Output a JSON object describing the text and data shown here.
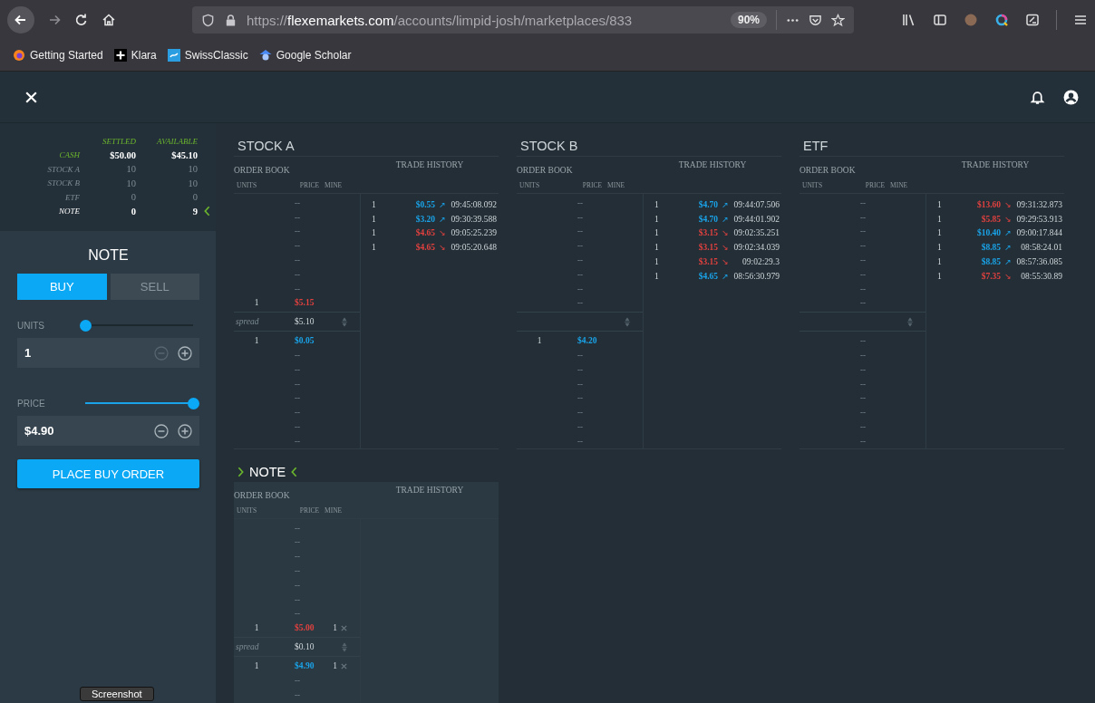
{
  "browser": {
    "url": "https://**flexemarkets.com**/accounts/limpid-josh/marketplaces/833",
    "zoom": "90%",
    "bookmarks": [
      {
        "label": "Getting Started",
        "kind": "firefox"
      },
      {
        "label": "Klara",
        "kind": "plus"
      },
      {
        "label": "SwissClassic",
        "kind": "swiss"
      },
      {
        "label": "Google Scholar",
        "kind": "scholar"
      }
    ]
  },
  "holdings": {
    "columns": [
      "SETTLED",
      "AVAILABLE"
    ],
    "rows": [
      {
        "kind": "cash",
        "label": "CASH",
        "settled": "$50.00",
        "available": "$45.10",
        "selected": false
      },
      {
        "kind": "holding",
        "label": "STOCK A",
        "settled": "10",
        "available": "10",
        "selected": false
      },
      {
        "kind": "holding",
        "label": "STOCK B",
        "settled": "10",
        "available": "10",
        "selected": false
      },
      {
        "kind": "holding",
        "label": "ETF",
        "settled": "0",
        "available": "0",
        "selected": false
      },
      {
        "kind": "holding",
        "label": "NOTE",
        "settled": "0",
        "available": "9",
        "selected": true
      }
    ]
  },
  "order_form": {
    "title": "NOTE",
    "tabs": [
      {
        "label": "BUY",
        "selected": true
      },
      {
        "label": "SELL",
        "selected": false
      }
    ],
    "fields": [
      {
        "label": "UNITS",
        "level": 0,
        "value": "1",
        "minus_disabled": true
      },
      {
        "label": "PRICE",
        "level": 1,
        "value": "$4.90",
        "minus_disabled": false
      }
    ],
    "submit": "PLACE BUY ORDER"
  },
  "markets": [
    {
      "title": "STOCK A",
      "selected": false,
      "order_book": {
        "heading": "ORDER BOOK",
        "columns": [
          "UNITS",
          "PRICE",
          "MINE"
        ],
        "asks": [
          {
            "price": "--"
          },
          {
            "price": "--"
          },
          {
            "price": "--"
          },
          {
            "price": "--"
          },
          {
            "price": "--"
          },
          {
            "price": "--"
          },
          {
            "price": "--"
          },
          {
            "units": "1",
            "price": "$5.15"
          }
        ],
        "spread": {
          "label": "spread",
          "value": "$5.10"
        },
        "bids": [
          {
            "units": "1",
            "price": "$0.05"
          },
          {
            "price": "--"
          },
          {
            "price": "--"
          },
          {
            "price": "--"
          },
          {
            "price": "--"
          },
          {
            "price": "--"
          },
          {
            "price": "--"
          },
          {
            "price": "--"
          }
        ]
      },
      "trade_history": {
        "heading": "TRADE HISTORY",
        "trades": [
          {
            "units": "1",
            "price": "$0.55",
            "arrow": "↗",
            "rising": true,
            "time": "09:45:08.092"
          },
          {
            "units": "1",
            "price": "$3.20",
            "arrow": "↗",
            "rising": true,
            "time": "09:30:39.588"
          },
          {
            "units": "1",
            "price": "$4.65",
            "arrow": "↘",
            "rising": false,
            "time": "09:05:25.239"
          },
          {
            "units": "1",
            "price": "$4.65",
            "arrow": "↘",
            "rising": false,
            "time": "09:05:20.648"
          }
        ]
      }
    },
    {
      "title": "STOCK B",
      "selected": false,
      "order_book": {
        "heading": "ORDER BOOK",
        "columns": [
          "UNITS",
          "PRICE",
          "MINE"
        ],
        "asks": [
          {
            "price": "--"
          },
          {
            "price": "--"
          },
          {
            "price": "--"
          },
          {
            "price": "--"
          },
          {
            "price": "--"
          },
          {
            "price": "--"
          },
          {
            "price": "--"
          },
          {
            "price": "--"
          }
        ],
        "bids": [
          {
            "units": "1",
            "price": "$4.20"
          },
          {
            "price": "--"
          },
          {
            "price": "--"
          },
          {
            "price": "--"
          },
          {
            "price": "--"
          },
          {
            "price": "--"
          },
          {
            "price": "--"
          },
          {
            "price": "--"
          }
        ]
      },
      "trade_history": {
        "heading": "TRADE HISTORY",
        "trades": [
          {
            "units": "1",
            "price": "$4.70",
            "arrow": "↗",
            "rising": true,
            "time": "09:44:07.506"
          },
          {
            "units": "1",
            "price": "$4.70",
            "arrow": "↗",
            "rising": true,
            "time": "09:44:01.902"
          },
          {
            "units": "1",
            "price": "$3.15",
            "arrow": "↘",
            "rising": false,
            "time": "09:02:35.251"
          },
          {
            "units": "1",
            "price": "$3.15",
            "arrow": "↘",
            "rising": false,
            "time": "09:02:34.039"
          },
          {
            "units": "1",
            "price": "$3.15",
            "arrow": "↘",
            "rising": false,
            "time": "09:02:29.3"
          },
          {
            "units": "1",
            "price": "$4.65",
            "arrow": "↗",
            "rising": true,
            "time": "08:56:30.979"
          }
        ]
      }
    },
    {
      "title": "ETF",
      "selected": false,
      "order_book": {
        "heading": "ORDER BOOK",
        "columns": [
          "UNITS",
          "PRICE",
          "MINE"
        ],
        "asks": [
          {
            "price": "--"
          },
          {
            "price": "--"
          },
          {
            "price": "--"
          },
          {
            "price": "--"
          },
          {
            "price": "--"
          },
          {
            "price": "--"
          },
          {
            "price": "--"
          },
          {
            "price": "--"
          }
        ],
        "bids": [
          {
            "price": "--"
          },
          {
            "price": "--"
          },
          {
            "price": "--"
          },
          {
            "price": "--"
          },
          {
            "price": "--"
          },
          {
            "price": "--"
          },
          {
            "price": "--"
          },
          {
            "price": "--"
          }
        ]
      },
      "trade_history": {
        "heading": "TRADE HISTORY",
        "trades": [
          {
            "units": "1",
            "price": "$13.60",
            "arrow": "↘",
            "rising": false,
            "time": "09:31:32.873"
          },
          {
            "units": "1",
            "price": "$5.85",
            "arrow": "↘",
            "rising": false,
            "time": "09:29:53.913"
          },
          {
            "units": "1",
            "price": "$10.40",
            "arrow": "↗",
            "rising": true,
            "time": "09:00:17.844"
          },
          {
            "units": "1",
            "price": "$8.85",
            "arrow": "↗",
            "rising": true,
            "time": "08:58:24.01"
          },
          {
            "units": "1",
            "price": "$8.85",
            "arrow": "↗",
            "rising": true,
            "time": "08:57:36.085"
          },
          {
            "units": "1",
            "price": "$7.35",
            "arrow": "↘",
            "rising": false,
            "time": "08:55:30.89"
          }
        ]
      }
    },
    {
      "title": "NOTE",
      "selected": true,
      "order_book": {
        "heading": "ORDER BOOK",
        "columns": [
          "UNITS",
          "PRICE",
          "MINE"
        ],
        "asks": [
          {
            "price": "--"
          },
          {
            "price": "--"
          },
          {
            "price": "--"
          },
          {
            "price": "--"
          },
          {
            "price": "--"
          },
          {
            "price": "--"
          },
          {
            "price": "--"
          },
          {
            "units": "1",
            "price": "$5.00",
            "mine": "1"
          }
        ],
        "spread": {
          "label": "spread",
          "value": "$0.10"
        },
        "bids": [
          {
            "units": "1",
            "price": "$4.90",
            "mine": "1"
          },
          {
            "price": "--"
          },
          {
            "price": "--"
          }
        ]
      },
      "trade_history": {
        "heading": "TRADE HISTORY"
      }
    }
  ],
  "tooltip": "Screenshot"
}
